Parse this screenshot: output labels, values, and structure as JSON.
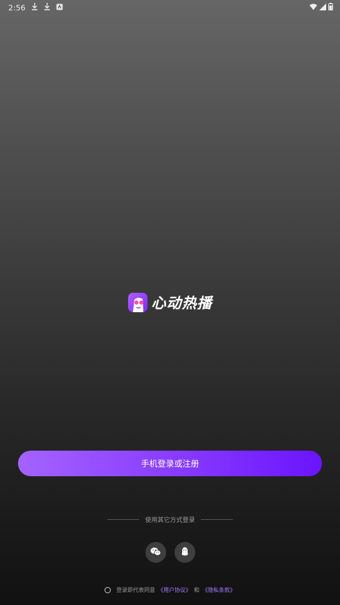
{
  "status_bar": {
    "time": "2:56",
    "left_icons": [
      "download-icon",
      "download-icon",
      "notification-icon"
    ],
    "right_icons": [
      "wifi-icon",
      "signal-icon",
      "battery-icon"
    ]
  },
  "app": {
    "name": "心动热播",
    "icon": "app-logo-icon",
    "accent_color": "#8a3dff"
  },
  "login": {
    "phone_button_label": "手机登录或注册"
  },
  "other_methods": {
    "label": "使用其它方式登录",
    "buttons": [
      {
        "name": "wechat",
        "icon": "wechat-icon"
      },
      {
        "name": "qq",
        "icon": "qq-icon"
      }
    ]
  },
  "agreement": {
    "prefix": "登录即代表同意",
    "user_agreement": "《用户协议》",
    "and": "和",
    "privacy_policy": "《隐私条款》",
    "link_color": "#a77bff"
  }
}
